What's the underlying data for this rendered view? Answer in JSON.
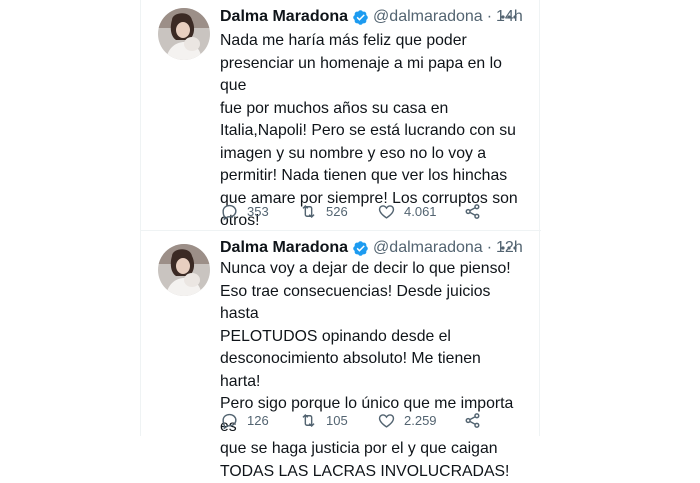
{
  "tweets": [
    {
      "name": "Dalma Maradona",
      "handle": "@dalmaradona",
      "separator": "·",
      "time": "14h",
      "text": "Nada me haría más feliz que poder\npresenciar un homenaje a mi papa en lo que\nfue por muchos años su casa en\nItalia,Napoli! Pero se está lucrando con su\nimagen y su nombre y eso no lo voy a\npermitir! Nada tienen que ver los hinchas\nque amare por siempre! Los corruptos son\notros!",
      "replies": "353",
      "retweets": "526",
      "likes": "4.061"
    },
    {
      "name": "Dalma Maradona",
      "handle": "@dalmaradona",
      "separator": "·",
      "time": "12h",
      "text": "Nunca voy a dejar de decir lo que pienso!\nEso trae consecuencias! Desde juicios hasta\nPELOTUDOS opinando desde el\ndesconocimiento absoluto! Me tienen harta!\nPero sigo porque lo único que me importa es\nque se haga justicia por el y que caigan\nTODAS LAS LACRAS INVOLUCRADAS!",
      "replies": "126",
      "retweets": "105",
      "likes": "2.259"
    }
  ],
  "icons": {
    "verified": "verified-badge-icon",
    "more": "more-horizontal-icon",
    "reply": "reply-icon",
    "retweet": "retweet-icon",
    "like": "heart-icon",
    "share": "share-icon"
  },
  "colors": {
    "text": "#0f1419",
    "secondary": "#536471",
    "verified": "#1d9bf0",
    "divider": "#eff3f4"
  }
}
